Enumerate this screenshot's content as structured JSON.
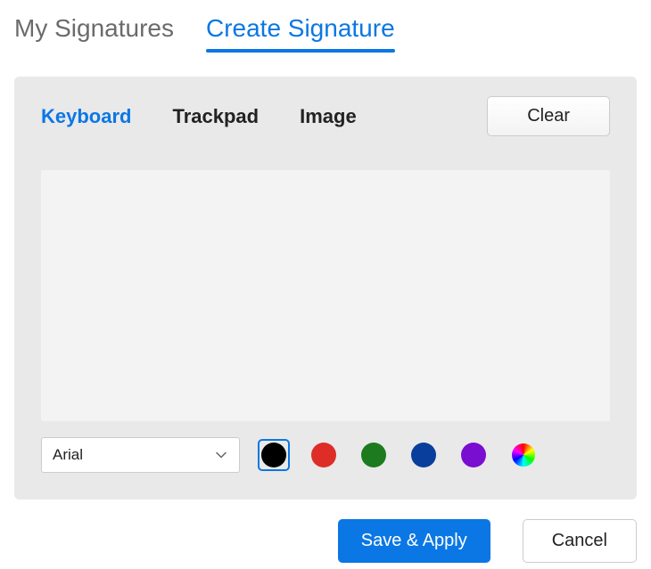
{
  "main_tabs": {
    "my_signatures": "My Signatures",
    "create_signature": "Create Signature"
  },
  "input_tabs": {
    "keyboard": "Keyboard",
    "trackpad": "Trackpad",
    "image": "Image"
  },
  "buttons": {
    "clear": "Clear",
    "save_apply": "Save & Apply",
    "cancel": "Cancel"
  },
  "font_select": {
    "value": "Arial"
  },
  "colors": {
    "black": "#000000",
    "red": "#de2d26",
    "green": "#1e7a1e",
    "blue": "#0a3e9c",
    "purple": "#7a0ed0",
    "rainbow": "rainbow"
  }
}
